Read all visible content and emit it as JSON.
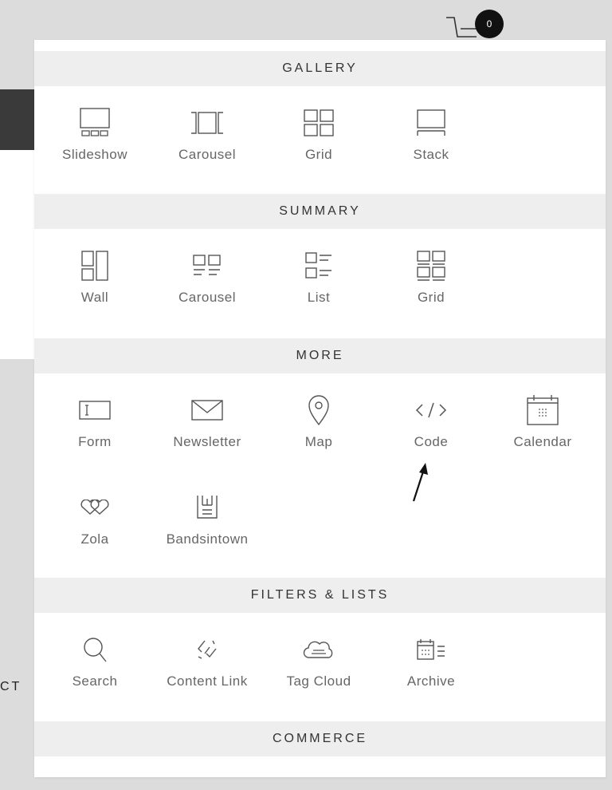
{
  "background": {
    "truncated_text": "CT"
  },
  "cart": {
    "count": "0"
  },
  "sections": {
    "gallery": {
      "title": "GALLERY",
      "items": [
        "Slideshow",
        "Carousel",
        "Grid",
        "Stack"
      ]
    },
    "summary": {
      "title": "SUMMARY",
      "items": [
        "Wall",
        "Carousel",
        "List",
        "Grid"
      ]
    },
    "more": {
      "title": "MORE",
      "items": [
        "Form",
        "Newsletter",
        "Map",
        "Code",
        "Calendar",
        "Zola",
        "Bandsintown"
      ]
    },
    "filters": {
      "title": "FILTERS & LISTS",
      "items": [
        "Search",
        "Content Link",
        "Tag Cloud",
        "Archive"
      ]
    },
    "commerce": {
      "title": "COMMERCE"
    }
  },
  "colors": {
    "icon_stroke": "#555555",
    "header_bg": "#eeeeee",
    "panel_bg": "#ffffff"
  }
}
